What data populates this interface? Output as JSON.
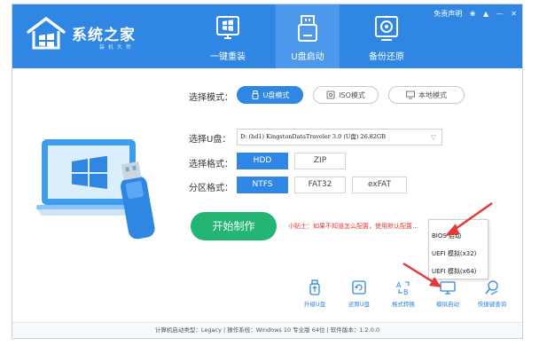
{
  "app": {
    "title": "系统之家",
    "subtitle": "装 机 大 师"
  },
  "window_controls": {
    "free_text": "免责声明",
    "pin": "❀",
    "skin": "▲",
    "minimize": "—",
    "close": "✕"
  },
  "tabs": [
    {
      "label": "一键重装",
      "icon": "windows-monitor-icon",
      "active": false
    },
    {
      "label": "U盘启动",
      "icon": "usb-drive-icon",
      "active": true
    },
    {
      "label": "备份还原",
      "icon": "backup-restore-icon",
      "active": false
    }
  ],
  "mode": {
    "label": "选择模式：",
    "options": [
      {
        "label": "U盘模式",
        "icon": "usb-icon",
        "active": true
      },
      {
        "label": "ISO模式",
        "icon": "disc-icon",
        "active": false
      },
      {
        "label": "本地模式",
        "icon": "monitor-icon",
        "active": false
      }
    ]
  },
  "drive": {
    "label": "选择U盘：",
    "value": "D: (hd1) KingstonDataTraveler 3.0 (U盘) 26.82GB",
    "arrow": "▽"
  },
  "format": {
    "label": "选择格式：",
    "options": [
      {
        "label": "HDD",
        "active": true
      },
      {
        "label": "ZIP",
        "active": false
      }
    ]
  },
  "partition": {
    "label": "分区格式：",
    "options": [
      {
        "label": "NTFS",
        "active": true
      },
      {
        "label": "FAT32",
        "active": false
      },
      {
        "label": "exFAT",
        "active": false
      }
    ]
  },
  "start_button": "开始制作",
  "tip": "小贴士：如果不知道怎么配置，使用默认配置...",
  "popup_menu": [
    "BIOS 启动",
    "UEFI 模拟(x32)",
    "UEFI 模拟(x64)"
  ],
  "tools": [
    {
      "label": "升级U盘",
      "icon": "usb-upgrade-icon"
    },
    {
      "label": "还原U盘",
      "icon": "usb-restore-icon"
    },
    {
      "label": "格式转换",
      "icon": "format-convert-icon"
    },
    {
      "label": "模拟启动",
      "icon": "simulate-boot-icon"
    },
    {
      "label": "快捷键查询",
      "icon": "hotkey-search-icon"
    }
  ],
  "status_bar": "计算机启动类型：Legacy | 操作系统：Windows 10 专业版 64位 | 软件版本：1.2.0.0",
  "colors": {
    "primary": "#2f86e3",
    "start_green": "#22b573",
    "tip_red": "#e53935",
    "arrow_red": "#e53935"
  }
}
